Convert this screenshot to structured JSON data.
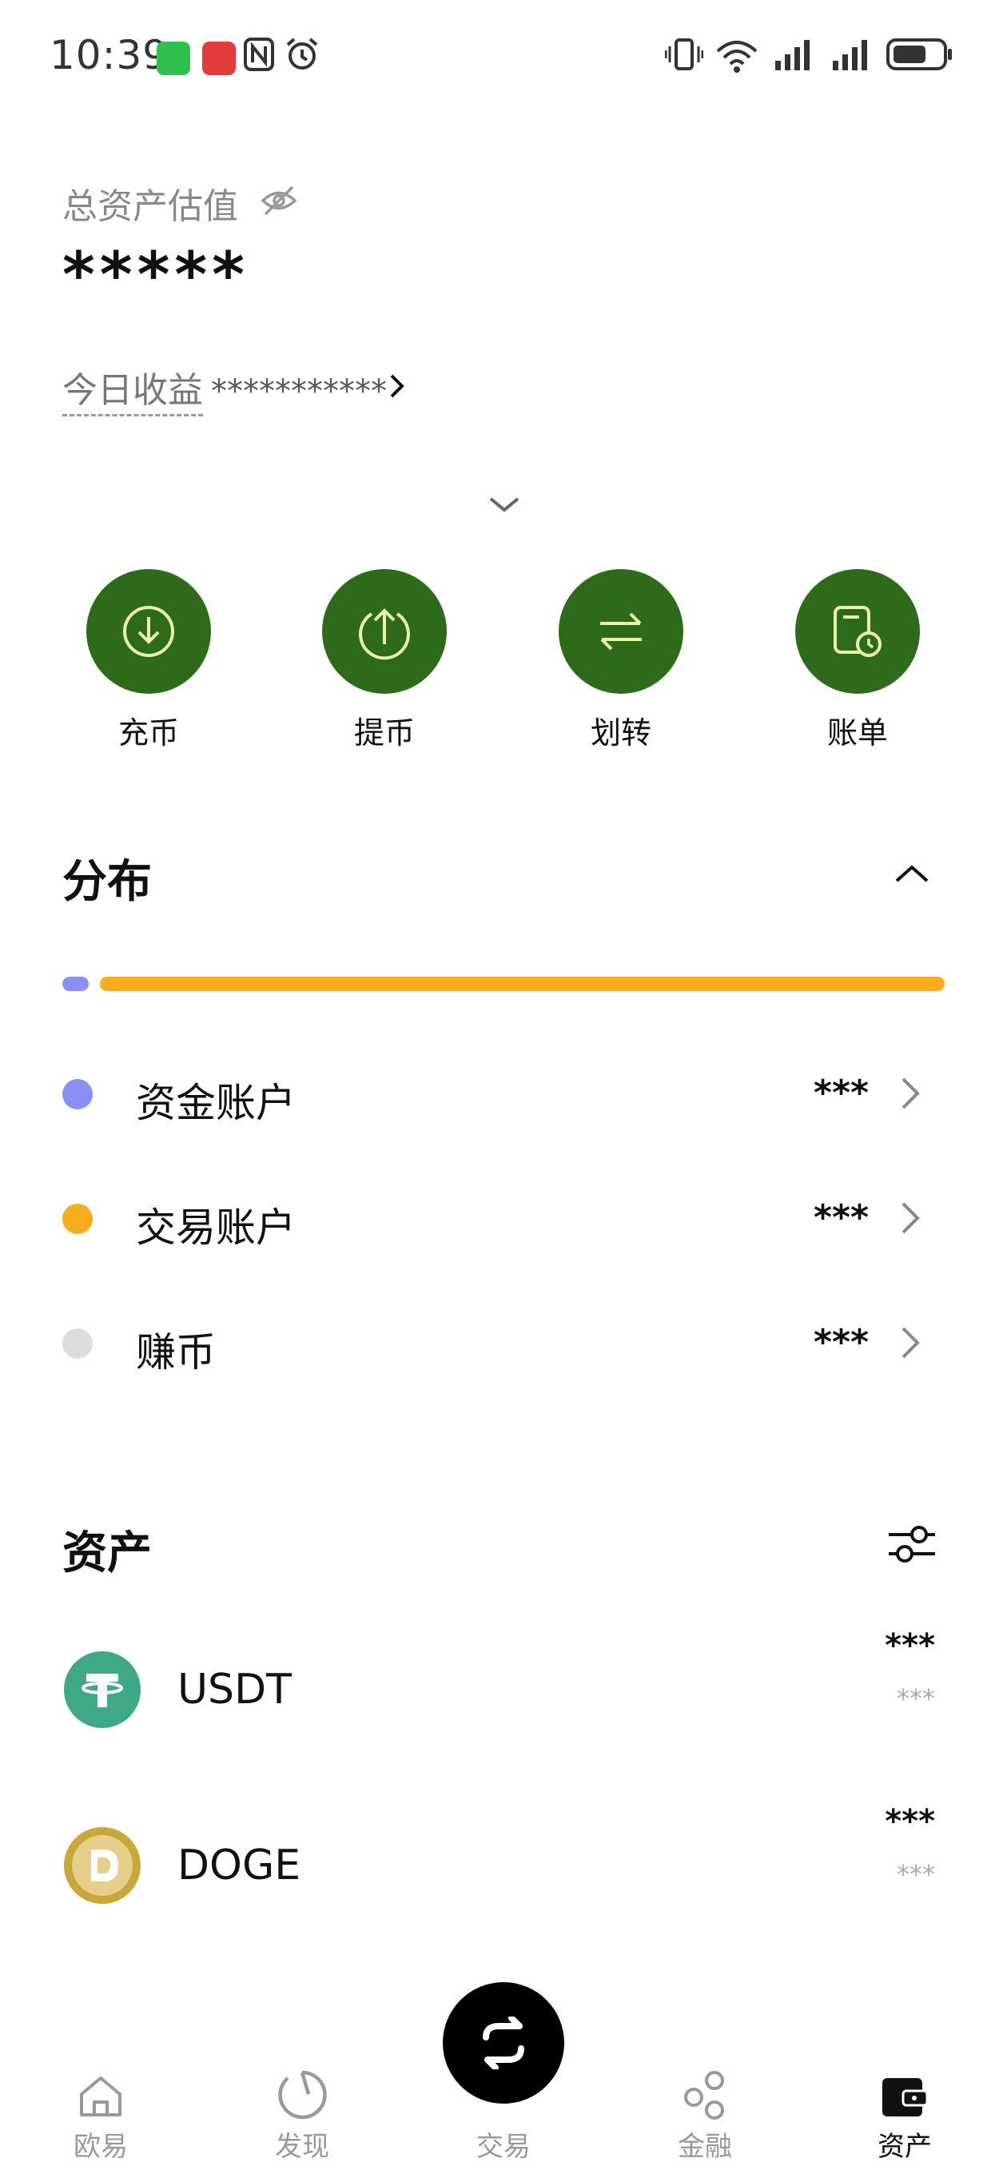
{
  "status_bar": {
    "time": "10:39"
  },
  "header": {
    "total_label": "总资产估值",
    "total_value": "*****",
    "today_label": "今日收益",
    "today_value": "***********"
  },
  "actions": [
    {
      "label": "充币",
      "icon": "deposit-icon"
    },
    {
      "label": "提币",
      "icon": "withdraw-icon"
    },
    {
      "label": "划转",
      "icon": "transfer-icon"
    },
    {
      "label": "账单",
      "icon": "bill-icon"
    }
  ],
  "distribution": {
    "title": "分布",
    "bar_fractions": {
      "funding": 0.03,
      "trading": 0.97
    },
    "accounts": [
      {
        "name": "资金账户",
        "value": "***",
        "color": "#8b8ff5"
      },
      {
        "name": "交易账户",
        "value": "***",
        "color": "#f7ad1d"
      },
      {
        "name": "赚币",
        "value": "***",
        "color": "#dcdcdc"
      }
    ]
  },
  "assets": {
    "title": "资产",
    "items": [
      {
        "symbol": "USDT",
        "value": "***",
        "sub_value": "***",
        "color": "#3fa987",
        "icon": "usdt-icon"
      },
      {
        "symbol": "DOGE",
        "value": "***",
        "sub_value": "***",
        "color": "#c9a83a",
        "icon": "doge-icon"
      }
    ]
  },
  "bottom_nav": {
    "items": [
      {
        "label": "欧易",
        "icon": "home-icon"
      },
      {
        "label": "发现",
        "icon": "discover-icon"
      },
      {
        "label": "交易",
        "icon": "trade-icon"
      },
      {
        "label": "金融",
        "icon": "finance-icon"
      },
      {
        "label": "资产",
        "icon": "wallet-icon"
      }
    ],
    "active": "资产"
  }
}
